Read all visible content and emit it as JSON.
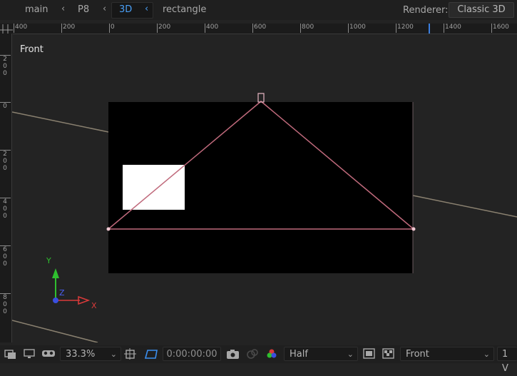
{
  "breadcrumb": {
    "items": [
      "main",
      "P8",
      "3D",
      "rectangle"
    ],
    "active": "3D"
  },
  "renderer": {
    "label": "Renderer:",
    "value": "Classic 3D"
  },
  "ruler": {
    "horizontal_labels": [
      "400",
      "200",
      "0",
      "200",
      "400",
      "600",
      "800",
      "1000",
      "1200",
      "1400",
      "1600"
    ],
    "vertical_labels": [
      "200",
      "0",
      "200",
      "400",
      "600",
      "800"
    ]
  },
  "viewport": {
    "view_name": "Front",
    "axes": {
      "x": "X",
      "y": "Y",
      "z": "Z"
    },
    "colors": {
      "comp_bg": "#000000",
      "layer": "#ffffff",
      "path": "#c06a7c",
      "guide": "#8a8170",
      "x_axis": "#d93a3a",
      "y_axis": "#2fbf2f",
      "z_axis": "#3a4fe0"
    }
  },
  "toolbar": {
    "zoom": "33.3%",
    "timecode": "0:00:00:00",
    "resolution": "Half",
    "view": "Front",
    "views_count": "1 V"
  }
}
